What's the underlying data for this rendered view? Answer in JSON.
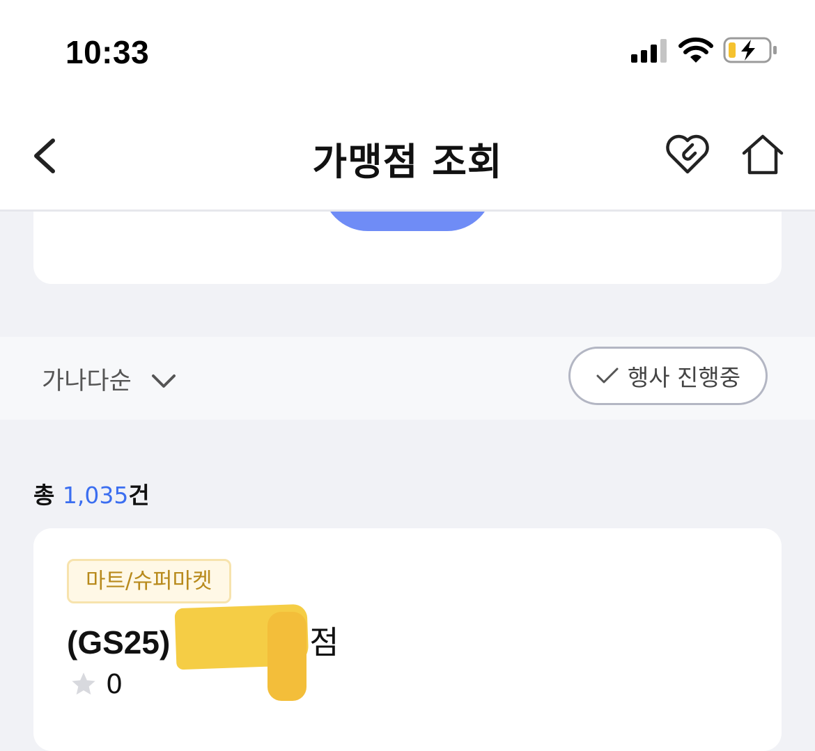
{
  "status_bar": {
    "time": "10:33"
  },
  "nav": {
    "title": "가맹점 조회"
  },
  "filter": {
    "sort_label": "가나다순",
    "event_toggle_label": "행사 진행중"
  },
  "results": {
    "total_prefix": "총 ",
    "total_count": "1,035",
    "total_suffix": "건",
    "items": [
      {
        "category": "마트/슈퍼마켓",
        "name_prefix": "(GS25)",
        "name_suffix": "점",
        "rating": "0"
      }
    ]
  },
  "colors": {
    "accent": "#3b6ef0",
    "search_button": "#6f8cf6",
    "badge_text": "#b88a1c",
    "badge_bg": "#fff8e6",
    "battery_charge": "#f5c22f"
  },
  "icons": [
    "back-chevron-icon",
    "heart-icon",
    "home-icon",
    "chevron-down-icon",
    "check-icon",
    "star-icon",
    "signal-icon",
    "wifi-icon",
    "battery-icon"
  ]
}
